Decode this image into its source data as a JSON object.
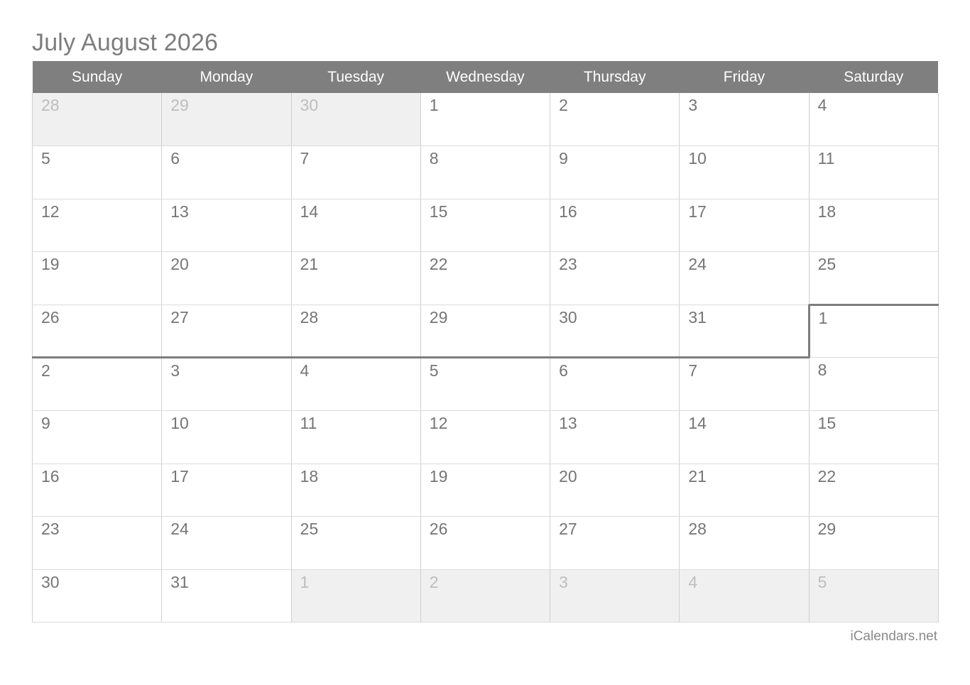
{
  "page": {
    "title": "July August 2026",
    "footer": "iCalendars.net",
    "accent_header_bg": "#7f7f7f",
    "header_text_color": "#ffffff",
    "day_text_color": "#757575",
    "muted_day_text_color": "#bdbdbd",
    "muted_day_bg": "#f0f0f0",
    "separator_color": "#7d7d7d",
    "grid_line_color": "#cfcfcf"
  },
  "weekdays": [
    "Sunday",
    "Monday",
    "Tuesday",
    "Wednesday",
    "Thursday",
    "Friday",
    "Saturday"
  ],
  "calendar": {
    "months_shown": [
      "July 2026",
      "August 2026"
    ],
    "weeks": [
      {
        "days": [
          {
            "n": "28",
            "muted": true
          },
          {
            "n": "29",
            "muted": true
          },
          {
            "n": "30",
            "muted": true
          },
          {
            "n": "1",
            "muted": false
          },
          {
            "n": "2",
            "muted": false
          },
          {
            "n": "3",
            "muted": false
          },
          {
            "n": "4",
            "muted": false
          }
        ]
      },
      {
        "days": [
          {
            "n": "5",
            "muted": false
          },
          {
            "n": "6",
            "muted": false
          },
          {
            "n": "7",
            "muted": false
          },
          {
            "n": "8",
            "muted": false
          },
          {
            "n": "9",
            "muted": false
          },
          {
            "n": "10",
            "muted": false
          },
          {
            "n": "11",
            "muted": false
          }
        ]
      },
      {
        "days": [
          {
            "n": "12",
            "muted": false
          },
          {
            "n": "13",
            "muted": false
          },
          {
            "n": "14",
            "muted": false
          },
          {
            "n": "15",
            "muted": false
          },
          {
            "n": "16",
            "muted": false
          },
          {
            "n": "17",
            "muted": false
          },
          {
            "n": "18",
            "muted": false
          }
        ]
      },
      {
        "days": [
          {
            "n": "19",
            "muted": false
          },
          {
            "n": "20",
            "muted": false
          },
          {
            "n": "21",
            "muted": false
          },
          {
            "n": "22",
            "muted": false
          },
          {
            "n": "23",
            "muted": false
          },
          {
            "n": "24",
            "muted": false
          },
          {
            "n": "25",
            "muted": false
          }
        ]
      },
      {
        "days": [
          {
            "n": "26",
            "muted": false,
            "month_end_bottom": true
          },
          {
            "n": "27",
            "muted": false,
            "month_end_bottom": true
          },
          {
            "n": "28",
            "muted": false,
            "month_end_bottom": true
          },
          {
            "n": "29",
            "muted": false,
            "month_end_bottom": true
          },
          {
            "n": "30",
            "muted": false,
            "month_end_bottom": true
          },
          {
            "n": "31",
            "muted": false,
            "month_end_bottom": true
          },
          {
            "n": "1",
            "muted": false,
            "month_start_top": true,
            "month_start_left": true
          }
        ]
      },
      {
        "days": [
          {
            "n": "2",
            "muted": false
          },
          {
            "n": "3",
            "muted": false
          },
          {
            "n": "4",
            "muted": false
          },
          {
            "n": "5",
            "muted": false
          },
          {
            "n": "6",
            "muted": false
          },
          {
            "n": "7",
            "muted": false
          },
          {
            "n": "8",
            "muted": false
          }
        ]
      },
      {
        "days": [
          {
            "n": "9",
            "muted": false
          },
          {
            "n": "10",
            "muted": false
          },
          {
            "n": "11",
            "muted": false
          },
          {
            "n": "12",
            "muted": false
          },
          {
            "n": "13",
            "muted": false
          },
          {
            "n": "14",
            "muted": false
          },
          {
            "n": "15",
            "muted": false
          }
        ]
      },
      {
        "days": [
          {
            "n": "16",
            "muted": false
          },
          {
            "n": "17",
            "muted": false
          },
          {
            "n": "18",
            "muted": false
          },
          {
            "n": "19",
            "muted": false
          },
          {
            "n": "20",
            "muted": false
          },
          {
            "n": "21",
            "muted": false
          },
          {
            "n": "22",
            "muted": false
          }
        ]
      },
      {
        "days": [
          {
            "n": "23",
            "muted": false
          },
          {
            "n": "24",
            "muted": false
          },
          {
            "n": "25",
            "muted": false
          },
          {
            "n": "26",
            "muted": false
          },
          {
            "n": "27",
            "muted": false
          },
          {
            "n": "28",
            "muted": false
          },
          {
            "n": "29",
            "muted": false
          }
        ]
      },
      {
        "days": [
          {
            "n": "30",
            "muted": false
          },
          {
            "n": "31",
            "muted": false
          },
          {
            "n": "1",
            "muted": true
          },
          {
            "n": "2",
            "muted": true
          },
          {
            "n": "3",
            "muted": true
          },
          {
            "n": "4",
            "muted": true
          },
          {
            "n": "5",
            "muted": true
          }
        ]
      }
    ]
  }
}
